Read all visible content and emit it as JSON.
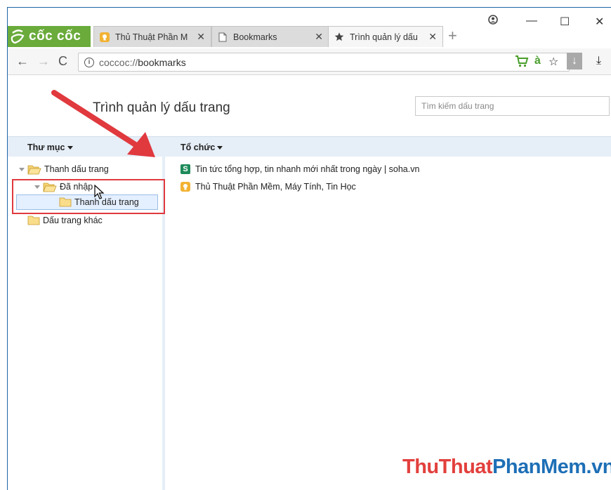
{
  "browser": {
    "brand": "cốc cốc",
    "tabs": [
      {
        "label": "Thủ Thuật Phần M",
        "icon": "bulb-icon"
      },
      {
        "label": "Bookmarks",
        "icon": "page-icon"
      },
      {
        "label": "Trình quản lý dấu",
        "icon": "star-icon"
      }
    ],
    "address": {
      "scheme": "coccoc://",
      "path": "bookmarks"
    },
    "toolbar_letter": "à"
  },
  "page": {
    "title": "Trình quản lý dấu trang",
    "search_placeholder": "Tìm kiếm dấu trang"
  },
  "headers": {
    "folders": "Thư mục",
    "organize": "Tổ chức"
  },
  "tree": [
    {
      "label": "Thanh dấu trang",
      "level": 0,
      "open": true
    },
    {
      "label": "Đã nhập",
      "level": 1,
      "open": true
    },
    {
      "label": "Thanh dấu trang",
      "level": 2,
      "selected": true
    },
    {
      "label": "Dấu trang khác",
      "level": 0
    }
  ],
  "bookmarks": [
    {
      "title": "Tin tức tổng hợp, tin nhanh mới nhất trong ngày | soha.vn",
      "icon": "soha-icon",
      "icon_letter": "S"
    },
    {
      "title": "Thủ Thuật Phần Mềm, Máy Tính, Tin Học",
      "icon": "bulb-icon"
    }
  ],
  "watermark": {
    "part1": "ThuThuat",
    "part2": "PhanMem.vn"
  },
  "colors": {
    "brand": "#6aab3b",
    "header": "#e6eef7",
    "selected": "#e4efff",
    "annotation": "#e0393e"
  }
}
